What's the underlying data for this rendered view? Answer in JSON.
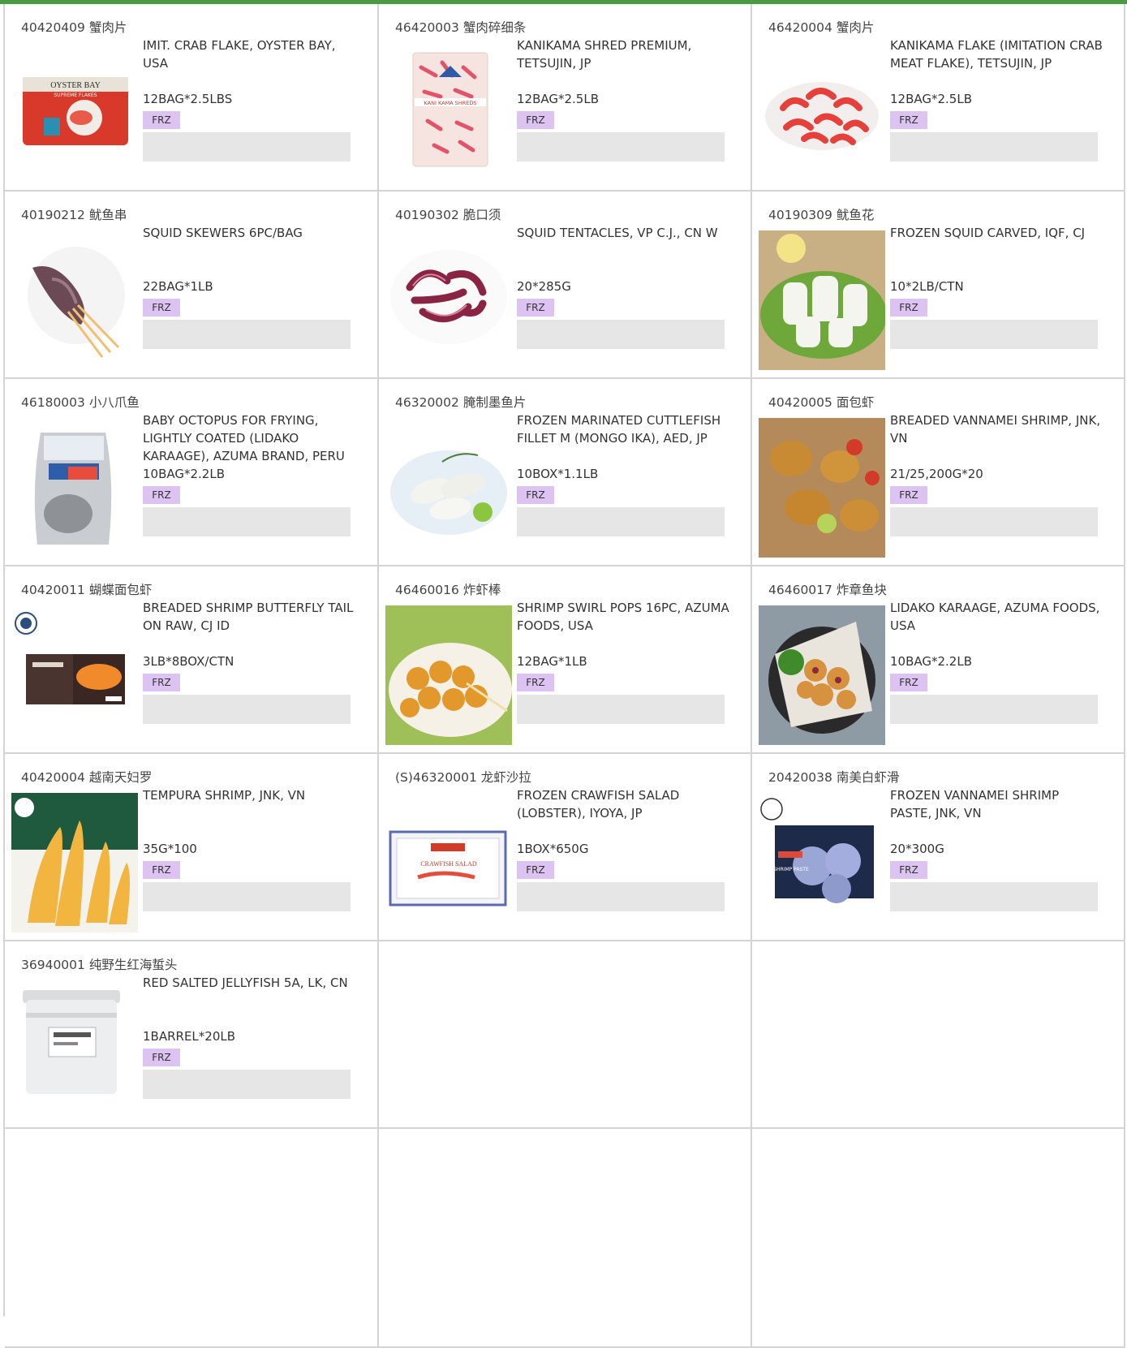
{
  "products": [
    {
      "code": "40420409 蟹肉片",
      "description": "IMIT. CRAB FLAKE, OYSTER BAY, USA",
      "pack": "12BAG*2.5LBS",
      "tag": "FRZ",
      "image_icon": "crab-flake-bag"
    },
    {
      "code": "46420003 蟹肉碎细条",
      "description": "KANIKAMA SHRED PREMIUM, TETSUJIN, JP",
      "pack": "12BAG*2.5LB",
      "tag": "FRZ",
      "image_icon": "kanikama-shred-bag"
    },
    {
      "code": "46420004 蟹肉片",
      "description": "KANIKAMA FLAKE (IMITATION CRAB MEAT FLAKE), TETSUJIN, JP",
      "pack": "12BAG*2.5LB",
      "tag": "FRZ",
      "image_icon": "crab-flake-pile"
    },
    {
      "code": "40190212 鱿鱼串",
      "description": "SQUID SKEWERS 6PC/BAG",
      "pack": "22BAG*1LB",
      "tag": "FRZ",
      "image_icon": "squid-skewer"
    },
    {
      "code": "40190302 脆口须",
      "description": "SQUID TENTACLES, VP C.J., CN W",
      "pack": "20*285G",
      "tag": "FRZ",
      "image_icon": "squid-tentacles"
    },
    {
      "code": "40190309 鱿鱼花",
      "description": "FROZEN SQUID CARVED, IQF,  CJ",
      "pack": "10*2LB/CTN",
      "tag": "FRZ",
      "image_icon": "squid-carved"
    },
    {
      "code": "46180003 小八爪鱼",
      "description": "BABY OCTOPUS FOR FRYING, LIGHTLY COATED (LIDAKO KARAAGE), AZUMA BRAND, PERU",
      "pack": "10BAG*2.2LB",
      "tag": "FRZ",
      "image_icon": "octopus-bag"
    },
    {
      "code": "46320002 腌制墨鱼片",
      "description": "FROZEN MARINATED CUTTLEFISH FILLET M (MONGO IKA), AED, JP",
      "pack": "10BOX*1.1LB",
      "tag": "FRZ",
      "image_icon": "cuttlefish-fillet"
    },
    {
      "code": "40420005 面包虾",
      "description": "BREADED VANNAMEI SHRIMP, JNK, VN",
      "pack": "21/25,200G*20",
      "tag": "FRZ",
      "image_icon": "breaded-shrimp"
    },
    {
      "code": "40420011 蝴蝶面包虾",
      "description": "BREADED SHRIMP BUTTERFLY TAIL ON RAW, CJ ID",
      "pack": "3LB*8BOX/CTN",
      "tag": "FRZ",
      "image_icon": "butterfly-shrimp-box"
    },
    {
      "code": "46460016 炸虾棒",
      "description": "SHRIMP SWIRL POPS 16PC, AZUMA FOODS, USA",
      "pack": "12BAG*1LB",
      "tag": "FRZ",
      "image_icon": "shrimp-pops"
    },
    {
      "code": "46460017 炸章鱼块",
      "description": "LIDAKO KARAAGE, AZUMA FOODS, USA",
      "pack": "10BAG*2.2LB",
      "tag": "FRZ",
      "image_icon": "octopus-karaage"
    },
    {
      "code": "40420004 越南天妇罗",
      "description": "TEMPURA SHRIMP, JNK, VN",
      "pack": "35G*100",
      "tag": "FRZ",
      "image_icon": "tempura-shrimp"
    },
    {
      "code": "(S)46320001 龙虾沙拉",
      "description": "FROZEN CRAWFISH SALAD (LOBSTER), IYOYA, JP",
      "pack": "1BOX*650G",
      "tag": "FRZ",
      "image_icon": "crawfish-salad-tray"
    },
    {
      "code": "20420038 南美白虾滑",
      "description": "FROZEN VANNAMEI SHRIMP PASTE, JNK, VN",
      "pack": "20*300G",
      "tag": "FRZ",
      "image_icon": "shrimp-paste-box"
    },
    {
      "code": "36940001 纯野生红海蜇头",
      "description": "RED SALTED JELLYFISH 5A, LK, CN",
      "pack": "1BARREL*20LB",
      "tag": "FRZ",
      "image_icon": "jellyfish-barrel"
    }
  ],
  "image_texts": {
    "oyster_bay": "OYSTER BAY",
    "oyster_bay_sub": "SUPREME FLAKES",
    "kanikama": "KANI KAMA SHREDS",
    "crawfish": "CRAWFISH SALAD",
    "shrimp_paste": "SHRIMP PASTE"
  }
}
